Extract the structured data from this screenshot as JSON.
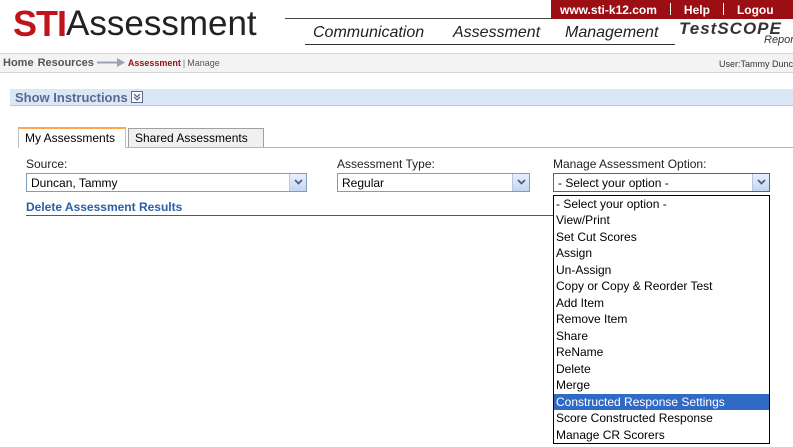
{
  "header": {
    "logo_brand": "STI",
    "logo_product": "Assessment",
    "top_links": [
      "www.sti-k12.com",
      "Help",
      "Logou"
    ],
    "nav": [
      "Communication",
      "Assessment",
      "Management"
    ],
    "testscope": "TestSCOPE",
    "testscope_sub": "Report",
    "brand_color": "#9b0f14"
  },
  "breadcrumb": {
    "home": "Home",
    "resources": "Resources",
    "current": "Assessment",
    "separator": "|",
    "page": "Manage",
    "user": "User:Tammy Dunc"
  },
  "instructions": {
    "label": "Show Instructions",
    "icon": "expand-icon"
  },
  "tabs": [
    {
      "label": "My Assessments",
      "active": true
    },
    {
      "label": "Shared Assessments",
      "active": false
    }
  ],
  "form": {
    "source_label": "Source:",
    "source_value": "Duncan, Tammy",
    "type_label": "Assessment Type:",
    "type_value": "Regular",
    "option_label": "Manage Assessment Option:",
    "option_value": "- Select your option -",
    "delete_link": "Delete Assessment Results"
  },
  "dropdown": {
    "options": [
      "- Select your option -",
      "View/Print",
      "Set Cut Scores",
      "Assign",
      "Un-Assign",
      "Copy or Copy & Reorder Test",
      "Add Item",
      "Remove Item",
      "Share",
      "ReName",
      "Delete",
      "Merge",
      "Constructed Response Settings",
      "Score Constructed Response",
      "Manage CR Scorers"
    ],
    "highlighted": "Constructed Response Settings",
    "highlight_color": "#316ac5"
  }
}
